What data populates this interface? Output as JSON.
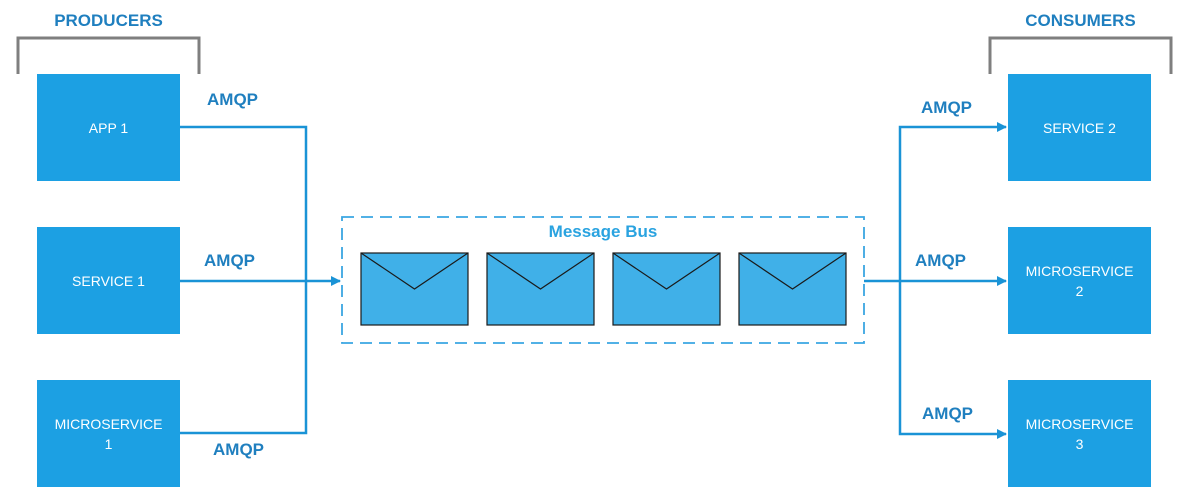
{
  "producers": {
    "heading": "PRODUCERS",
    "items": [
      {
        "label": "APP 1"
      },
      {
        "label": "SERVICE 1"
      },
      {
        "label": "MICROSERVICE\n1"
      }
    ]
  },
  "consumers": {
    "heading": "CONSUMERS",
    "items": [
      {
        "label": "SERVICE 2"
      },
      {
        "label": "MICROSERVICE\n2"
      },
      {
        "label": "MICROSERVICE\n3"
      }
    ]
  },
  "bus": {
    "title": "Message Bus",
    "message_count": 4
  },
  "protocol_labels": {
    "producer_1": "AMQP",
    "producer_2": "AMQP",
    "producer_3": "AMQP",
    "consumer_1": "AMQP",
    "consumer_2": "AMQP",
    "consumer_3": "AMQP"
  },
  "colors": {
    "box": "#1ca0e3",
    "line": "#1a93d6",
    "envelope": "#40b0e8",
    "heading": "#1f7fbf",
    "bracket": "#7f7f7f"
  }
}
